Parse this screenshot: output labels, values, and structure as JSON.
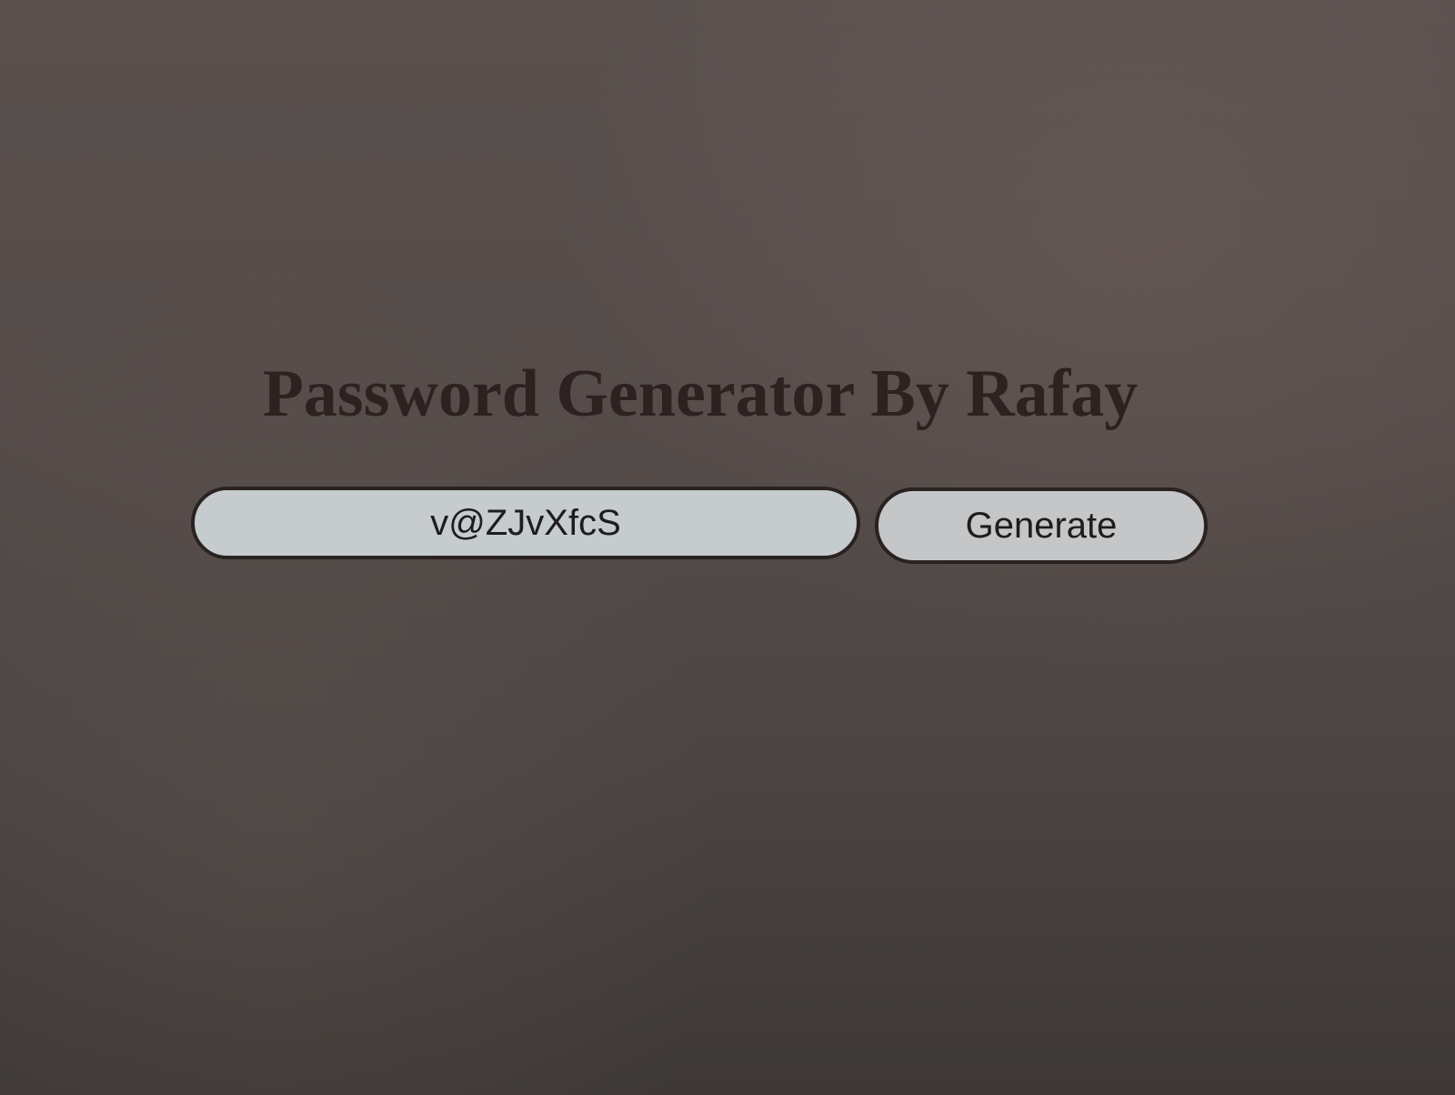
{
  "page": {
    "title": "Password Generator By Rafay"
  },
  "password_field": {
    "value": "v@ZJvXfcS"
  },
  "generate_button": {
    "label": "Generate"
  },
  "colors": {
    "background": "#554c4a",
    "title_text": "#2e2220",
    "field_background": "#c6cbcd",
    "button_background": "#c4c6c7",
    "border": "#2a2220"
  }
}
